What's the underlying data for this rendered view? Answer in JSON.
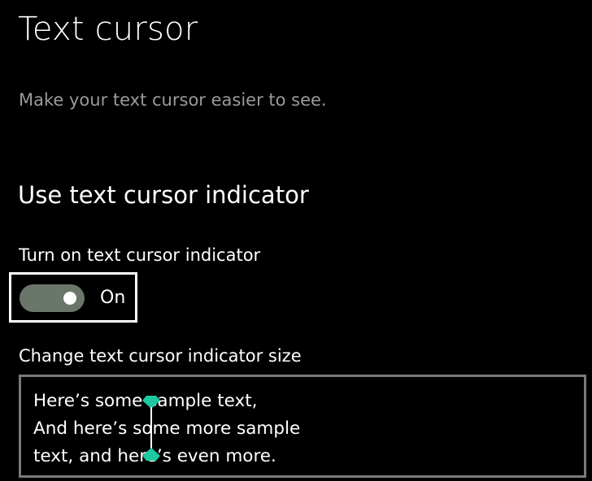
{
  "page": {
    "title": "Text cursor",
    "description": "Make your text cursor easier to see."
  },
  "indicator_section": {
    "heading": "Use text cursor indicator",
    "toggle_label": "Turn on text cursor indicator",
    "toggle_state": "On",
    "toggle_on": true,
    "size_label": "Change text cursor indicator size",
    "preview_lines": [
      "Here’s some sample text,",
      "And here’s some more sample",
      "text, and here’s even more."
    ]
  },
  "colors": {
    "background": "#000000",
    "toggle_track": "#6a766a",
    "indicator": "#1ec8a0",
    "preview_border": "#7a7a7a",
    "secondary_text": "#9a9a9a"
  },
  "icons": {
    "cursor_indicator": "text-cursor-indicator-icon"
  }
}
